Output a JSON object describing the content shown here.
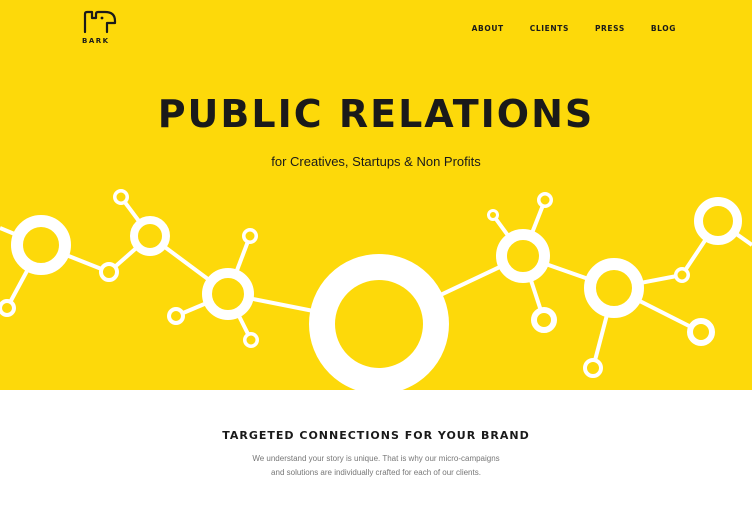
{
  "colors": {
    "hero_background": "#fdd90a",
    "network": "#ffffff",
    "text": "#1a1a1a",
    "muted_text": "#777777"
  },
  "header": {
    "logo_icon": "dog-head-icon",
    "logo_text": "BARK",
    "nav": [
      "ABOUT",
      "CLIENTS",
      "PRESS",
      "BLOG"
    ]
  },
  "hero": {
    "title": "PUBLIC RELATIONS",
    "subtitle": "for Creatives, Startups & Non Profits",
    "graphic": "network-illustration"
  },
  "section": {
    "title": "TARGETED CONNECTIONS FOR YOUR BRAND",
    "body_lines": [
      "We understand your story is unique. That is why our micro-campaigns",
      "and solutions are individually crafted for each of our clients."
    ]
  }
}
